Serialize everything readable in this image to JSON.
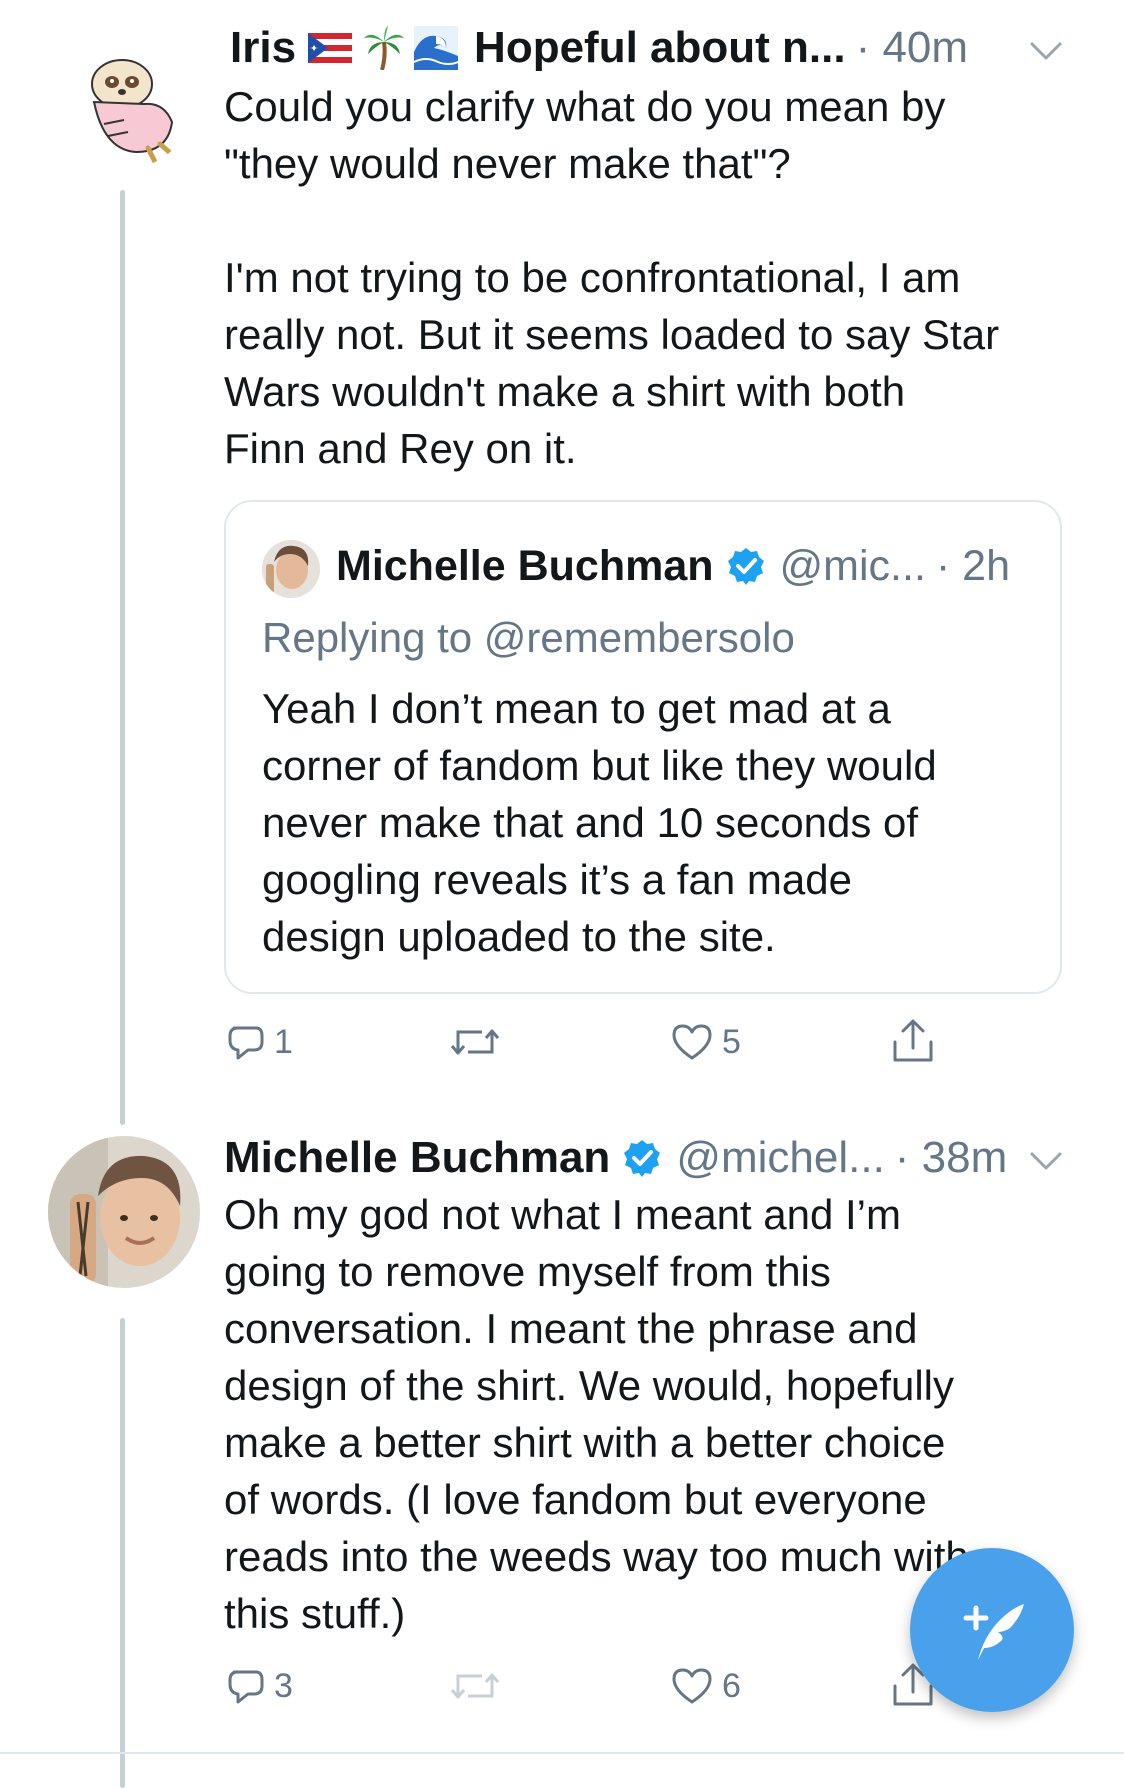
{
  "tweet1": {
    "name": "Iris",
    "display_suffix": "Hopeful about n...",
    "time": "· 40m",
    "icons": [
      "puerto-rico-flag-icon",
      "palm-tree-icon",
      "wave-icon"
    ],
    "text": "Could you clarify what do you mean by\n\"they would never make that\"?\n\nI'm not trying to be confrontational, I am\nreally not. But it seems loaded to say Star\nWars wouldn't make a shirt with both\nFinn and Rey on it.",
    "quote": {
      "name": "Michelle Buchman",
      "handle": "@mic...",
      "time": "· 2h",
      "replying": "Replying to @remembersolo",
      "text": "Yeah I don’t mean to get mad at a\ncorner of fandom but like they would\nnever make that and 10 seconds of\ngoogling reveals it’s a fan made\ndesign uploaded to the site."
    },
    "actions": {
      "reply_count": "1",
      "retweet_count": "",
      "like_count": "5"
    }
  },
  "tweet2": {
    "name": "Michelle Buchman",
    "handle": "@michel...",
    "time": "· 38m",
    "text": "Oh my god not what I meant and I’m\ngoing to remove myself from this\nconversation. I meant the phrase and\ndesign of the shirt. We would, hopefully\nmake a better shirt with a better choice\nof words. (I love fandom but everyone\nreads into the weeds way too much with\nthis stuff.)",
    "actions": {
      "reply_count": "3",
      "retweet_count": "",
      "like_count": "6"
    }
  },
  "colors": {
    "accent": "#1da1f2",
    "fab": "#4aa1eb",
    "secondary_text": "#657786",
    "border": "#e1e8ed"
  }
}
